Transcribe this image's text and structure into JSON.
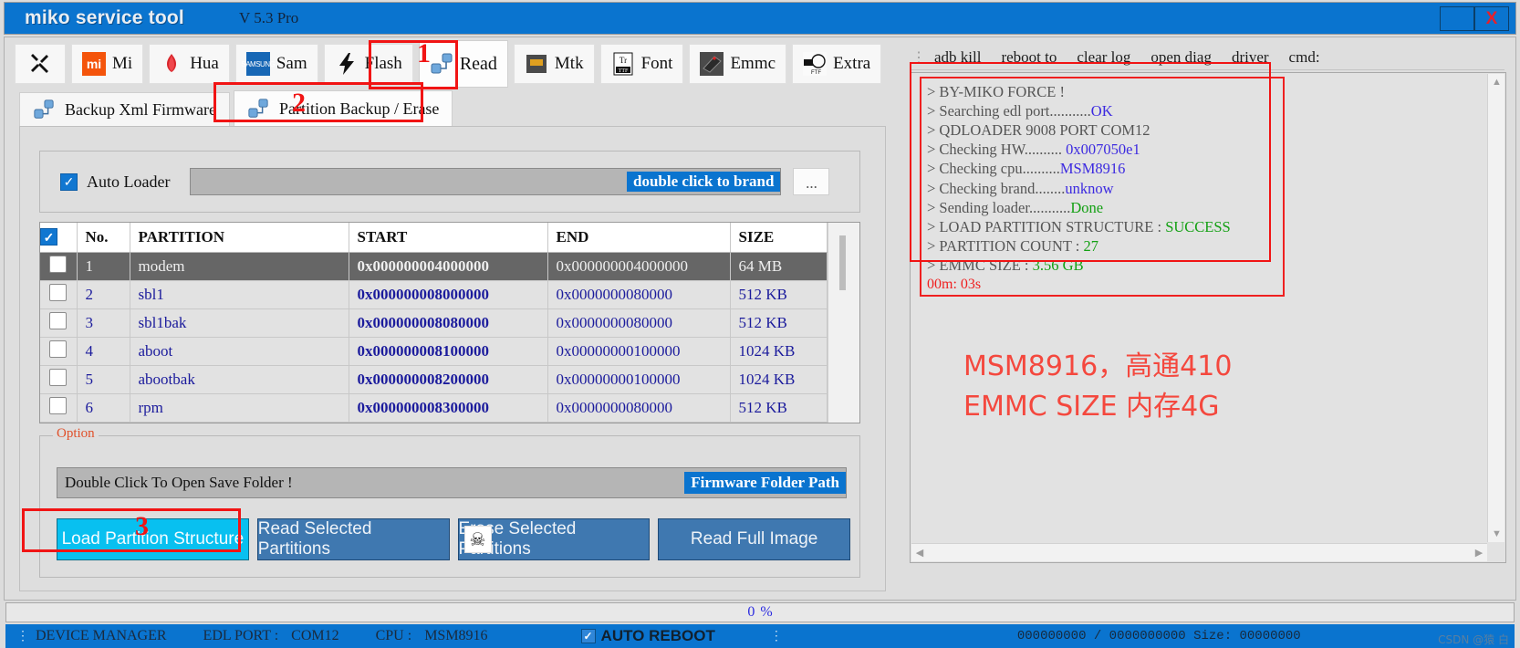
{
  "window": {
    "title": "miko service tool",
    "version": "V 5.3 Pro",
    "minimize_label": "",
    "close_label": "X"
  },
  "toolbar": [
    {
      "label": "",
      "icon": "wrench-icon"
    },
    {
      "label": "Mi",
      "icon": "xiaomi-icon"
    },
    {
      "label": "Hua",
      "icon": "huawei-icon"
    },
    {
      "label": "Sam",
      "icon": "samsung-icon"
    },
    {
      "label": "Flash",
      "icon": "lightning-icon"
    },
    {
      "label": "Read",
      "icon": "read-icon"
    },
    {
      "label": "Mtk",
      "icon": "mtk-icon"
    },
    {
      "label": "Font",
      "icon": "font-icon"
    },
    {
      "label": "Emmc",
      "icon": "emmc-icon"
    },
    {
      "label": "Extra",
      "icon": "extra-icon"
    }
  ],
  "subtabs": [
    {
      "label": "Backup Xml Firmware",
      "icon": "backup-icon"
    },
    {
      "label": "Partition Backup / Erase",
      "icon": "partition-icon"
    }
  ],
  "loader": {
    "checkbox_label": "Auto Loader",
    "checked": true,
    "path_value": "",
    "hint": "double click to brand",
    "browse_label": "..."
  },
  "table": {
    "headers": [
      "",
      "No.",
      "PARTITION",
      "START",
      "END",
      "SIZE"
    ],
    "header_checked": true,
    "rows": [
      {
        "no": "1",
        "partition": "modem",
        "start": "0x000000004000000",
        "end": "0x000000004000000",
        "size": "64 MB",
        "selected": true,
        "checked": false
      },
      {
        "no": "2",
        "partition": "sbl1",
        "start": "0x000000008000000",
        "end": "0x0000000080000",
        "size": "512 KB",
        "selected": false,
        "checked": false
      },
      {
        "no": "3",
        "partition": "sbl1bak",
        "start": "0x000000008080000",
        "end": "0x0000000080000",
        "size": "512 KB",
        "selected": false,
        "checked": false
      },
      {
        "no": "4",
        "partition": "aboot",
        "start": "0x000000008100000",
        "end": "0x00000000100000",
        "size": "1024 KB",
        "selected": false,
        "checked": false
      },
      {
        "no": "5",
        "partition": "abootbak",
        "start": "0x000000008200000",
        "end": "0x00000000100000",
        "size": "1024 KB",
        "selected": false,
        "checked": false
      },
      {
        "no": "6",
        "partition": "rpm",
        "start": "0x000000008300000",
        "end": "0x0000000080000",
        "size": "512 KB",
        "selected": false,
        "checked": false
      }
    ]
  },
  "option": {
    "legend": "Option",
    "save_folder_text": "Double Click To Open Save Folder !",
    "folder_path_tag": "Firmware Folder Path",
    "buttons": [
      {
        "label": "Load Partition Structure",
        "style": "cyan"
      },
      {
        "label": "Read Selected Partitions",
        "style": "blue"
      },
      {
        "label": "Erase Selected Partitions",
        "style": "blue",
        "icon": "skull-icon"
      },
      {
        "label": "Read Full Image",
        "style": "blue"
      }
    ]
  },
  "right_menu": [
    "adb kill",
    "reboot to",
    "clear log",
    "open diag",
    "driver",
    "cmd:"
  ],
  "log": {
    "lines": [
      {
        "text": "> BY-MIKO FORCE !",
        "value": "",
        "value_color": ""
      },
      {
        "text": "> Searching edl port...........",
        "value": "OK",
        "value_color": "blue"
      },
      {
        "text": "> QDLOADER 9008 PORT COM12",
        "value": "",
        "value_color": ""
      },
      {
        "text": "> Checking HW.......... ",
        "value": "0x007050e1",
        "value_color": "blue"
      },
      {
        "text": "> Checking cpu..........",
        "value": "MSM8916",
        "value_color": "blue"
      },
      {
        "text": "> Checking brand........",
        "value": "unknow",
        "value_color": "blue"
      },
      {
        "text": "> Sending loader...........",
        "value": "Done",
        "value_color": "green"
      },
      {
        "text": "> LOAD PARTITION  STRUCTURE  :  ",
        "value": "SUCCESS",
        "value_color": "green"
      },
      {
        "text": "> PARTITION COUNT  :  ",
        "value": "27",
        "value_color": "green"
      },
      {
        "text": "> EMMC SIZE   :  ",
        "value": "3.56 GB",
        "value_color": "green"
      }
    ],
    "timer": "00m: 03s"
  },
  "annotation": {
    "line1": "MSM8916，高通410",
    "line2": "EMMC SIZE 内存4G",
    "markers": [
      "1",
      "2",
      "3"
    ]
  },
  "progress": {
    "percent_value": "0",
    "percent_sign": "%"
  },
  "statusbar": {
    "device_manager": "DEVICE MANAGER",
    "edl_port_label": "EDL PORT :",
    "edl_port_value": "COM12",
    "cpu_label": "CPU :",
    "cpu_value": "MSM8916",
    "auto_reboot_label": "AUTO REBOOT",
    "auto_reboot_checked": true,
    "counters": "000000000 / 0000000000 Size: 00000000",
    "watermark": "CSDN @猿 白"
  },
  "colors": {
    "title_blue": "#0a74cf",
    "accent_red": "#f11414",
    "button_blue": "#3f78b0",
    "button_cyan": "#08c0f0",
    "log_green": "#13a013",
    "log_blue": "#3c2ae0",
    "note_red": "#f4483e"
  }
}
